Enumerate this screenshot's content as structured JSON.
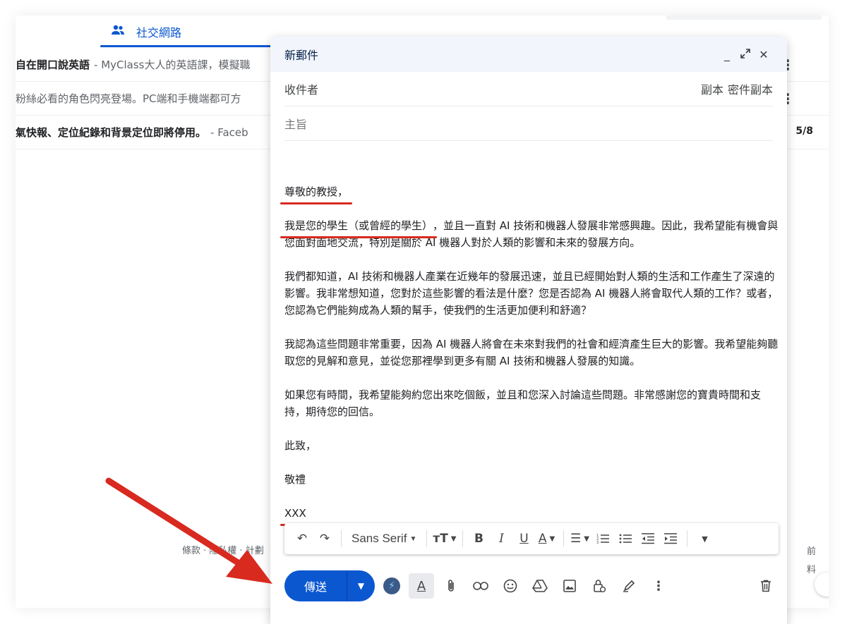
{
  "inbox": {
    "social_tab_label": "社交網路",
    "rows": [
      {
        "subject": "自在開口說英語",
        "snippet": "- MyClass大人的英語課，模擬職",
        "bold": true,
        "date": ""
      },
      {
        "subject": "粉絲必看的角色閃亮登場。PC端和手機端都可方",
        "snippet": "",
        "bold": false,
        "date": ""
      },
      {
        "subject": "氣快報、定位紀錄和背景定位即將停用。",
        "snippet": "- Faceb",
        "bold": true,
        "date": "5/8"
      }
    ],
    "footer_terms": "條款 · 隱私權 · 計劃",
    "footer_right_line1": "前",
    "footer_right_line2": "料"
  },
  "compose": {
    "title": "新郵件",
    "to_label": "收件者",
    "cc_label": "副本",
    "bcc_label": "密件副本",
    "subject_placeholder": "主旨",
    "body": {
      "greeting": "尊敬的教授，",
      "p1_lead": "我是您的學生（或曾經的學生）",
      "p1_rest": "，並且一直對 AI 技術和機器人發展非常感興趣。因此，我希望能有機會與您面對面地交流，特別是關於 AI 機器人對於人類的影響和未來的發展方向。",
      "p2": "我們都知道，AI 技術和機器人產業在近幾年的發展迅速，並且已經開始對人類的生活和工作產生了深遠的影響。我非常想知道，您對於這些影響的看法是什麼？您是否認為 AI 機器人將會取代人類的工作？或者，您認為它們能夠成為人類的幫手，使我們的生活更加便利和舒適？",
      "p3": "我認為這些問題非常重要，因為 AI 機器人將會在未來對我們的社會和經濟產生巨大的影響。我希望能夠聽取您的見解和意見，並從您那裡學到更多有關 AI 技術和機器人發展的知識。",
      "p4": "如果您有時間，我希望能夠約您出來吃個飯，並且和您深入討論這些問題。非常感謝您的寶貴時間和支持，期待您的回信。",
      "closing": "此致，",
      "regards": "敬禮",
      "signature": "XXX"
    },
    "toolbar": {
      "font_name": "Sans Serif"
    },
    "send_label": "傳送"
  },
  "colors": {
    "accent": "#0b57d0",
    "annotation_red": "#d82a1f"
  }
}
